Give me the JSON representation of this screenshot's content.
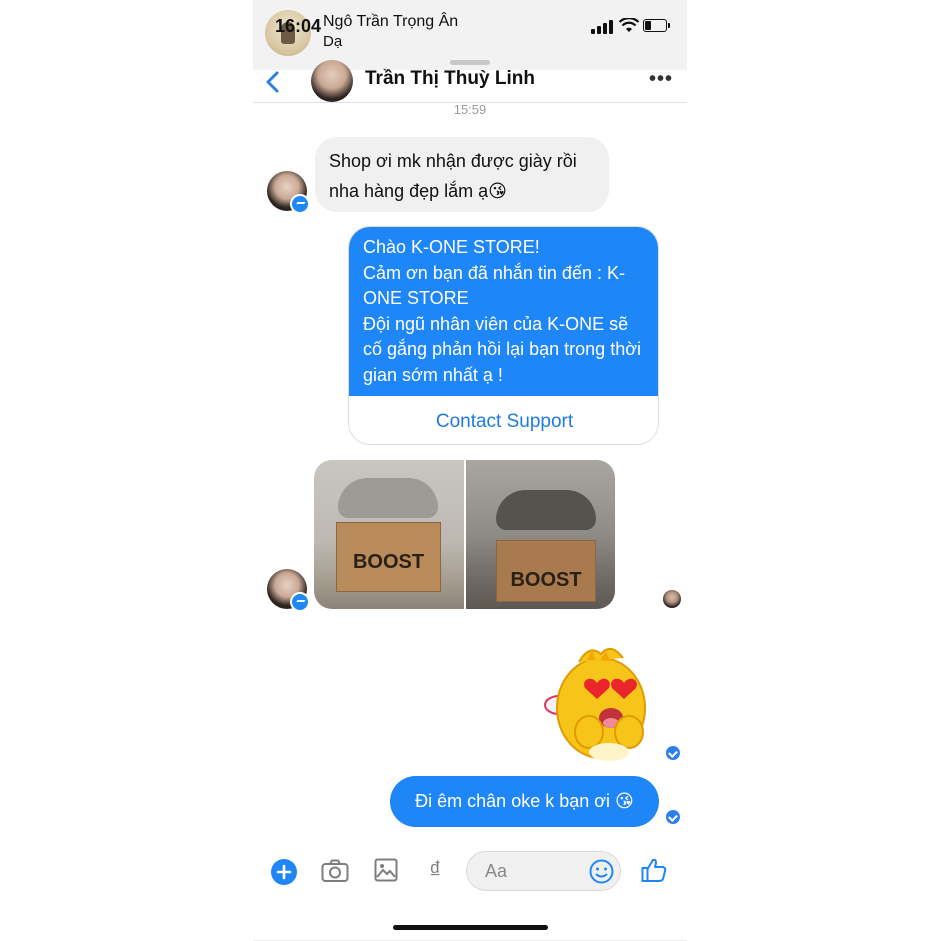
{
  "status_bar": {
    "time": "16:04"
  },
  "notification": {
    "sender": "Ngô Trần Trọng Ân",
    "message": "Dạ"
  },
  "header": {
    "contact_name": "Trần Thị Thuỳ Linh",
    "more": "•••"
  },
  "timestamp": "15:59",
  "messages": {
    "incoming_text": "Shop ơi mk nhận được giày rồi nha hàng đẹp lắm ạ😘",
    "auto_reply": "Chào K-ONE STORE!\nCảm ơn bạn đã nhắn tin đến : K-ONE STORE\nĐội ngũ nhân viên của K-ONE sẽ cố gắng phản hồi lại bạn trong thời gian sớm nhất ạ !",
    "auto_reply_button": "Contact Support",
    "photo_label_1": "BOOST",
    "photo_label_2": "BOOST",
    "outgoing_text": "Đi êm chân oke k bạn ơi 😘"
  },
  "composer": {
    "placeholder": "Aa",
    "currency_symbol": "₫"
  },
  "colors": {
    "accent": "#1f86f8",
    "incoming_bubble": "#f1f0f0"
  }
}
